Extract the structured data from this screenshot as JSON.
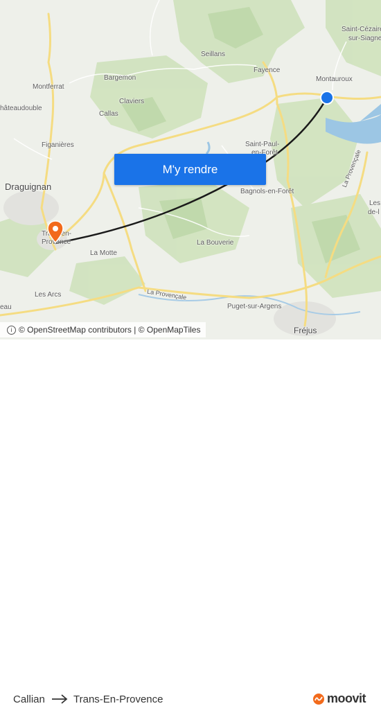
{
  "map": {
    "places": [
      {
        "name": "Saint-Cézaire",
        "key": "p0"
      },
      {
        "name": "sur-Siagne",
        "key": "p1"
      },
      {
        "name": "Seillans",
        "key": "p2"
      },
      {
        "name": "Fayence",
        "key": "p3"
      },
      {
        "name": "Montauroux",
        "key": "p4"
      },
      {
        "name": "Bargemon",
        "key": "p5"
      },
      {
        "name": "Montferrat",
        "key": "p6"
      },
      {
        "name": "Claviers",
        "key": "p7"
      },
      {
        "name": "hâteaudouble",
        "key": "p8"
      },
      {
        "name": "Callas",
        "key": "p9"
      },
      {
        "name": "Saint-Paul-",
        "key": "p10"
      },
      {
        "name": "en-Forêt",
        "key": "p11"
      },
      {
        "name": "Figanières",
        "key": "p12"
      },
      {
        "name": "Draguignan",
        "key": "p13"
      },
      {
        "name": "Bagnols-en-Forêt",
        "key": "p14"
      },
      {
        "name": "Les",
        "key": "p15"
      },
      {
        "name": "de-l",
        "key": "p16"
      },
      {
        "name": "Trans-en-",
        "key": "p17"
      },
      {
        "name": "Provence",
        "key": "p18"
      },
      {
        "name": "La Bouverie",
        "key": "p19"
      },
      {
        "name": "La Motte",
        "key": "p20"
      },
      {
        "name": "Les Arcs",
        "key": "p21"
      },
      {
        "name": "Puget-sur-Argens",
        "key": "p22"
      },
      {
        "name": "Fréjus",
        "key": "p23"
      },
      {
        "name": "eau",
        "key": "p24"
      }
    ],
    "road_labels": {
      "provencale_1": "La Provençale",
      "provencale_2": "La Provençale"
    },
    "colors": {
      "route_line": "#1a1a1a",
      "origin_dot": "#1a73e8",
      "destination_pin": "#f26a1b",
      "water": "#9cc6e4",
      "forest": "#cfe2bd",
      "road": "#f5dc82"
    },
    "icons": {
      "origin": "origin-dot",
      "destination": "destination-pin-icon"
    }
  },
  "cta": {
    "label": "M'y rendre"
  },
  "attribution": {
    "info_icon": "i",
    "text": "© OpenStreetMap contributors | © OpenMapTiles"
  },
  "footer": {
    "from": "Callian",
    "to": "Trans-En-Provence",
    "arrow_icon": "arrow-right-icon",
    "brand": "moovit",
    "brand_icon": "moovit-logo-icon"
  }
}
